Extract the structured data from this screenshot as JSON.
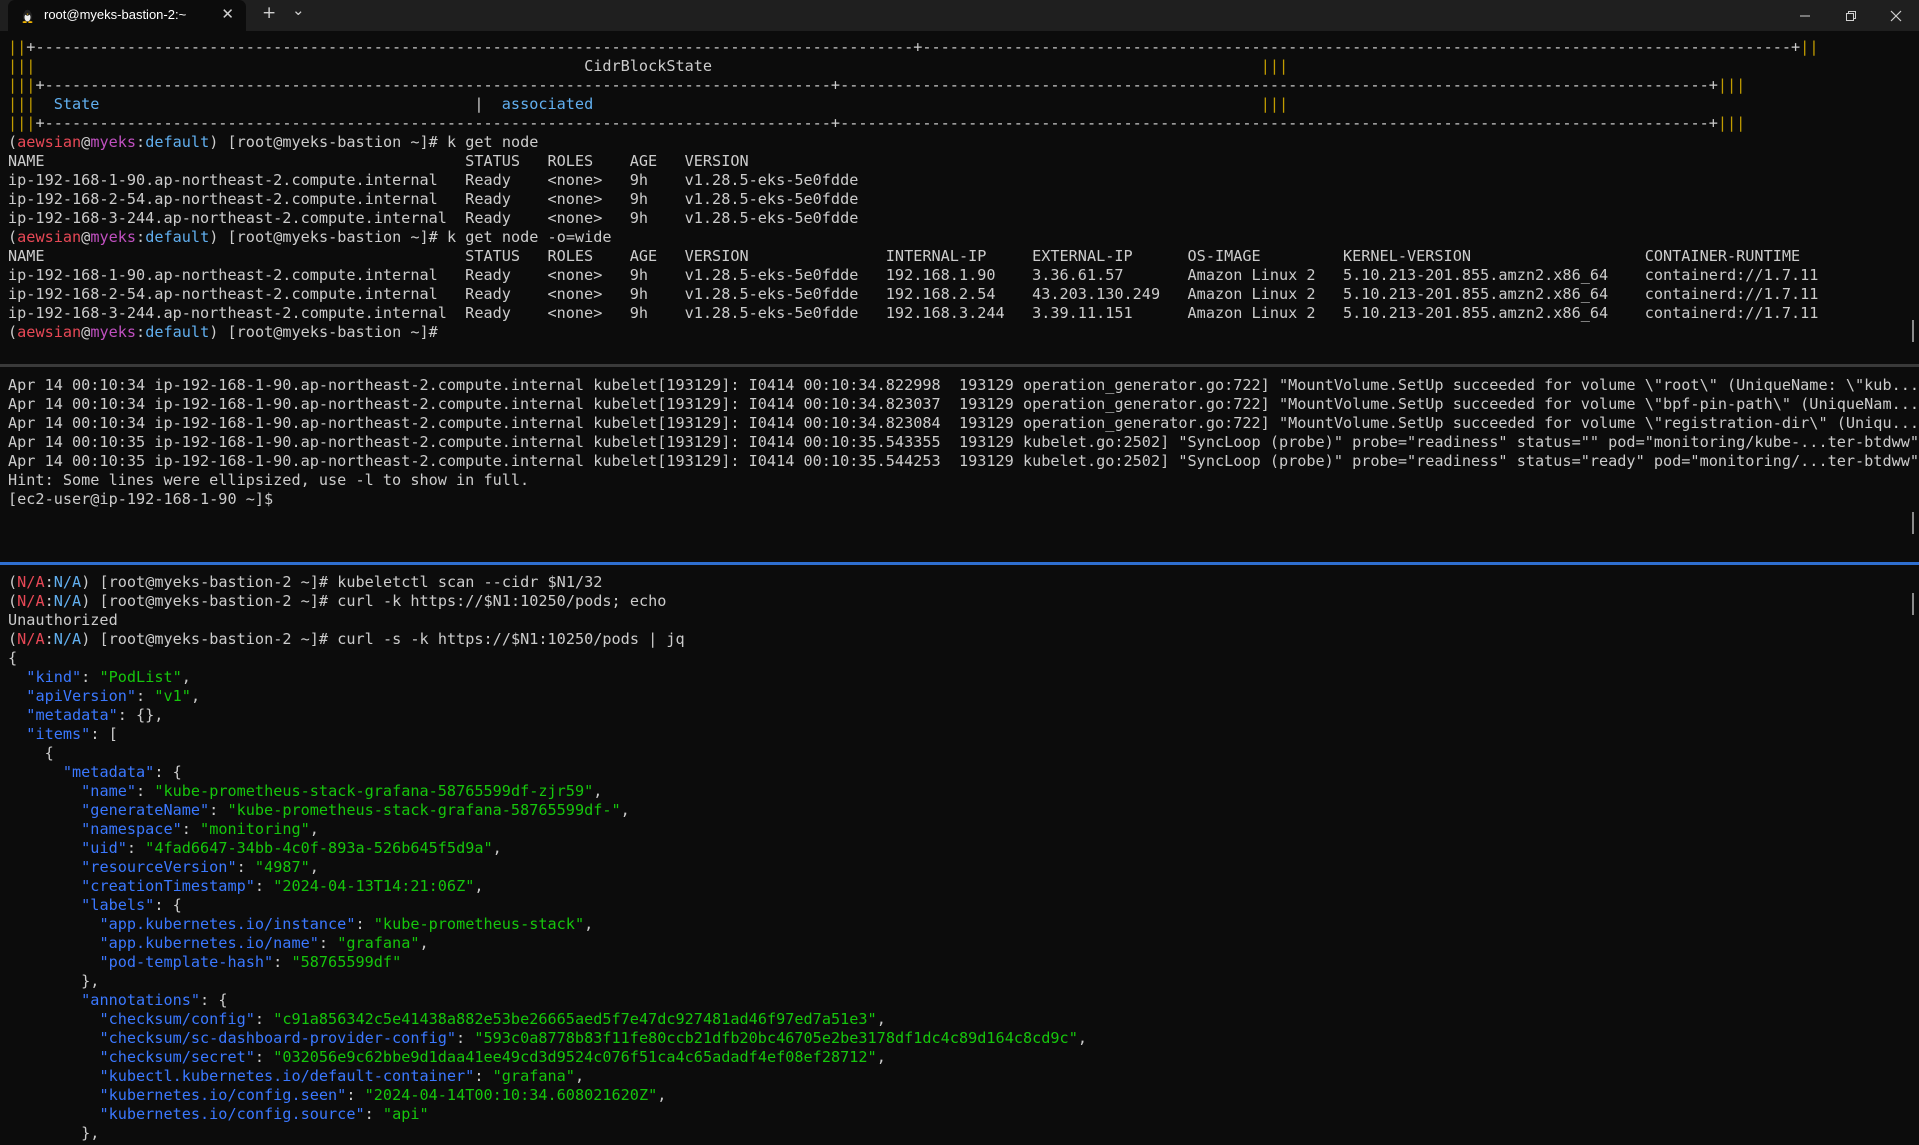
{
  "titlebar": {
    "tab_title": "root@myeks-bastion-2:~",
    "icon": "linux-penguin-icon",
    "new_tab_symbol": "+",
    "dropdown_symbol": "⌄",
    "close_tab_symbol": "✕"
  },
  "window_controls": {
    "minimize": "minimize-icon",
    "maximize": "maximize-icon",
    "close": "close-icon"
  },
  "colors": {
    "user": "#e74856",
    "host": "#c050c0",
    "context": "#61afef",
    "table_border": "#c19c00",
    "json_key": "#3b78ff",
    "json_string": "#16c60c",
    "active_divider": "#2f6fd0"
  },
  "pane1": {
    "table": {
      "border_top": "+------------------------------------------------------------------------------------------------+-----------------------------------------------------------------------------------------------+",
      "title": "CidrBlockState",
      "border_mid": "+--------------------------------------------------------------------------------------+-----------------------------------------------------------------------------------------------+",
      "state_label": "State",
      "state_value": "associated",
      "border_bottom": "+--------------------------------------------------------------------------------------+-----------------------------------------------------------------------------------------------+"
    },
    "prompt": {
      "user": "aewsian",
      "host": "myeks",
      "ctx": "default",
      "rest": "[root@myeks-bastion ~]# "
    },
    "cmd1": "k get node",
    "get_node": [
      "NAME                                              STATUS   ROLES    AGE   VERSION",
      "ip-192-168-1-90.ap-northeast-2.compute.internal   Ready    <none>   9h    v1.28.5-eks-5e0fdde",
      "ip-192-168-2-54.ap-northeast-2.compute.internal   Ready    <none>   9h    v1.28.5-eks-5e0fdde",
      "ip-192-168-3-244.ap-northeast-2.compute.internal  Ready    <none>   9h    v1.28.5-eks-5e0fdde"
    ],
    "cmd2": "k get node -o=wide",
    "get_node_wide": [
      "NAME                                              STATUS   ROLES    AGE   VERSION               INTERNAL-IP     EXTERNAL-IP      OS-IMAGE         KERNEL-VERSION                   CONTAINER-RUNTIME",
      "ip-192-168-1-90.ap-northeast-2.compute.internal   Ready    <none>   9h    v1.28.5-eks-5e0fdde   192.168.1.90    3.36.61.57       Amazon Linux 2   5.10.213-201.855.amzn2.x86_64    containerd://1.7.11",
      "ip-192-168-2-54.ap-northeast-2.compute.internal   Ready    <none>   9h    v1.28.5-eks-5e0fdde   192.168.2.54    43.203.130.249   Amazon Linux 2   5.10.213-201.855.amzn2.x86_64    containerd://1.7.11",
      "ip-192-168-3-244.ap-northeast-2.compute.internal  Ready    <none>   9h    v1.28.5-eks-5e0fdde   192.168.3.244   3.39.11.151      Amazon Linux 2   5.10.213-201.855.amzn2.x86_64    containerd://1.7.11"
    ]
  },
  "pane2": {
    "log": [
      "Apr 14 00:10:34 ip-192-168-1-90.ap-northeast-2.compute.internal kubelet[193129]: I0414 00:10:34.822998  193129 operation_generator.go:722] \"MountVolume.SetUp succeeded for volume \\\"root\\\" (UniqueName: \\\"kub...",
      "Apr 14 00:10:34 ip-192-168-1-90.ap-northeast-2.compute.internal kubelet[193129]: I0414 00:10:34.823037  193129 operation_generator.go:722] \"MountVolume.SetUp succeeded for volume \\\"bpf-pin-path\\\" (UniqueNam...",
      "Apr 14 00:10:34 ip-192-168-1-90.ap-northeast-2.compute.internal kubelet[193129]: I0414 00:10:34.823084  193129 operation_generator.go:722] \"MountVolume.SetUp succeeded for volume \\\"registration-dir\\\" (Uniqu...",
      "Apr 14 00:10:35 ip-192-168-1-90.ap-northeast-2.compute.internal kubelet[193129]: I0414 00:10:35.543355  193129 kubelet.go:2502] \"SyncLoop (probe)\" probe=\"readiness\" status=\"\" pod=\"monitoring/kube-...ter-btdww\"",
      "Apr 14 00:10:35 ip-192-168-1-90.ap-northeast-2.compute.internal kubelet[193129]: I0414 00:10:35.544253  193129 kubelet.go:2502] \"SyncLoop (probe)\" probe=\"readiness\" status=\"ready\" pod=\"monitoring/...ter-btdww\"",
      "Hint: Some lines were ellipsized, use -l to show in full.",
      "[ec2-user@ip-192-168-1-90 ~]$"
    ]
  },
  "pane3": {
    "prompt": {
      "na1": "N/A",
      "na2": "N/A",
      "rest": "[root@myeks-bastion-2 ~]# "
    },
    "cmd1": "kubeletctl scan --cidr $N1/32",
    "cmd2": "curl -k https://$N1:10250/pods; echo",
    "unauthorized": "Unauthorized",
    "cmd3": "curl -s -k https://$N1:10250/pods | jq",
    "json": {
      "kind": "PodList",
      "apiVersion": "v1",
      "name": "kube-prometheus-stack-grafana-58765599df-zjr59",
      "generateName": "kube-prometheus-stack-grafana-58765599df-",
      "namespace": "monitoring",
      "uid": "4fad6647-34bb-4c0f-893a-526b645f5d9a",
      "resourceVersion": "4987",
      "creationTimestamp": "2024-04-13T14:21:06Z",
      "label_instance": "kube-prometheus-stack",
      "label_name": "grafana",
      "pod_template_hash": "58765599df",
      "checksum_config": "c91a856342c5e41438a882e53be26665aed5f7e47dc927481ad46f97ed7a51e3",
      "checksum_sc": "593c0a8778b83f11fe80ccb21dfb20bc46705e2be3178df1dc4c89d164c8cd9c",
      "checksum_secret": "032056e9c62bbe9d1daa41ee49cd3d9524c076f51ca4c65adadf4ef08ef28712",
      "default_container": "grafana",
      "config_seen": "2024-04-14T00:10:34.608021620Z",
      "config_source": "api"
    }
  }
}
